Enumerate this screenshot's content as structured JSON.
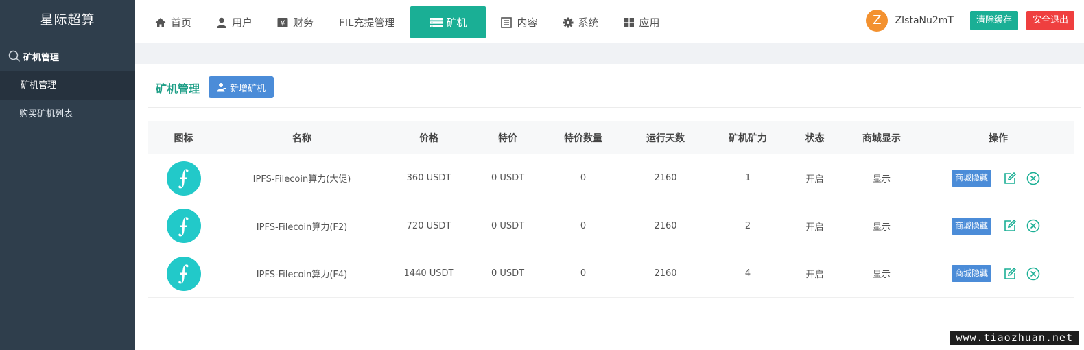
{
  "app": {
    "brand": "星际超算"
  },
  "sidebar": {
    "section_label": "矿机管理",
    "items": [
      {
        "label": "矿机管理"
      },
      {
        "label": "购买矿机列表"
      }
    ]
  },
  "nav": {
    "items": [
      {
        "label": "首页",
        "icon": "home-icon"
      },
      {
        "label": "用户",
        "icon": "user-icon"
      },
      {
        "label": "财务",
        "icon": "finance-icon"
      },
      {
        "label": "FIL充提管理",
        "icon": ""
      },
      {
        "label": "矿机",
        "icon": "server-icon"
      },
      {
        "label": "内容",
        "icon": "content-icon"
      },
      {
        "label": "系统",
        "icon": "gear-icon"
      },
      {
        "label": "应用",
        "icon": "apps-icon"
      }
    ]
  },
  "user": {
    "avatar_letter": "Z",
    "name": "ZIstaNu2mT",
    "clear_cache_label": "清除缓存",
    "logout_label": "安全退出"
  },
  "page": {
    "title": "矿机管理",
    "add_label": "新增矿机"
  },
  "table": {
    "headers": [
      "图标",
      "名称",
      "价格",
      "特价",
      "特价数量",
      "运行天数",
      "矿机矿力",
      "状态",
      "商城显示",
      "操作"
    ],
    "rows": [
      {
        "name": "IPFS-Filecoin算力(大促)",
        "price": "360 USDT",
        "special": "0 USDT",
        "special_qty": "0",
        "days": "2160",
        "power": "1",
        "status": "开启",
        "shop_display": "显示",
        "hide_label": "商城隐藏"
      },
      {
        "name": "IPFS-Filecoin算力(F2)",
        "price": "720 USDT",
        "special": "0 USDT",
        "special_qty": "0",
        "days": "2160",
        "power": "2",
        "status": "开启",
        "shop_display": "显示",
        "hide_label": "商城隐藏"
      },
      {
        "name": "IPFS-Filecoin算力(F4)",
        "price": "1440 USDT",
        "special": "0 USDT",
        "special_qty": "0",
        "days": "2160",
        "power": "4",
        "status": "开启",
        "shop_display": "显示",
        "hide_label": "商城隐藏"
      }
    ],
    "coin_glyph": "⨍"
  },
  "colors": {
    "accent": "#1aaf95",
    "sidebar": "#2f3e4c",
    "blue": "#4b8cd8",
    "danger": "#ef3f3f",
    "coin": "#22c9c9"
  },
  "watermark": "www.tiaozhuan.net"
}
